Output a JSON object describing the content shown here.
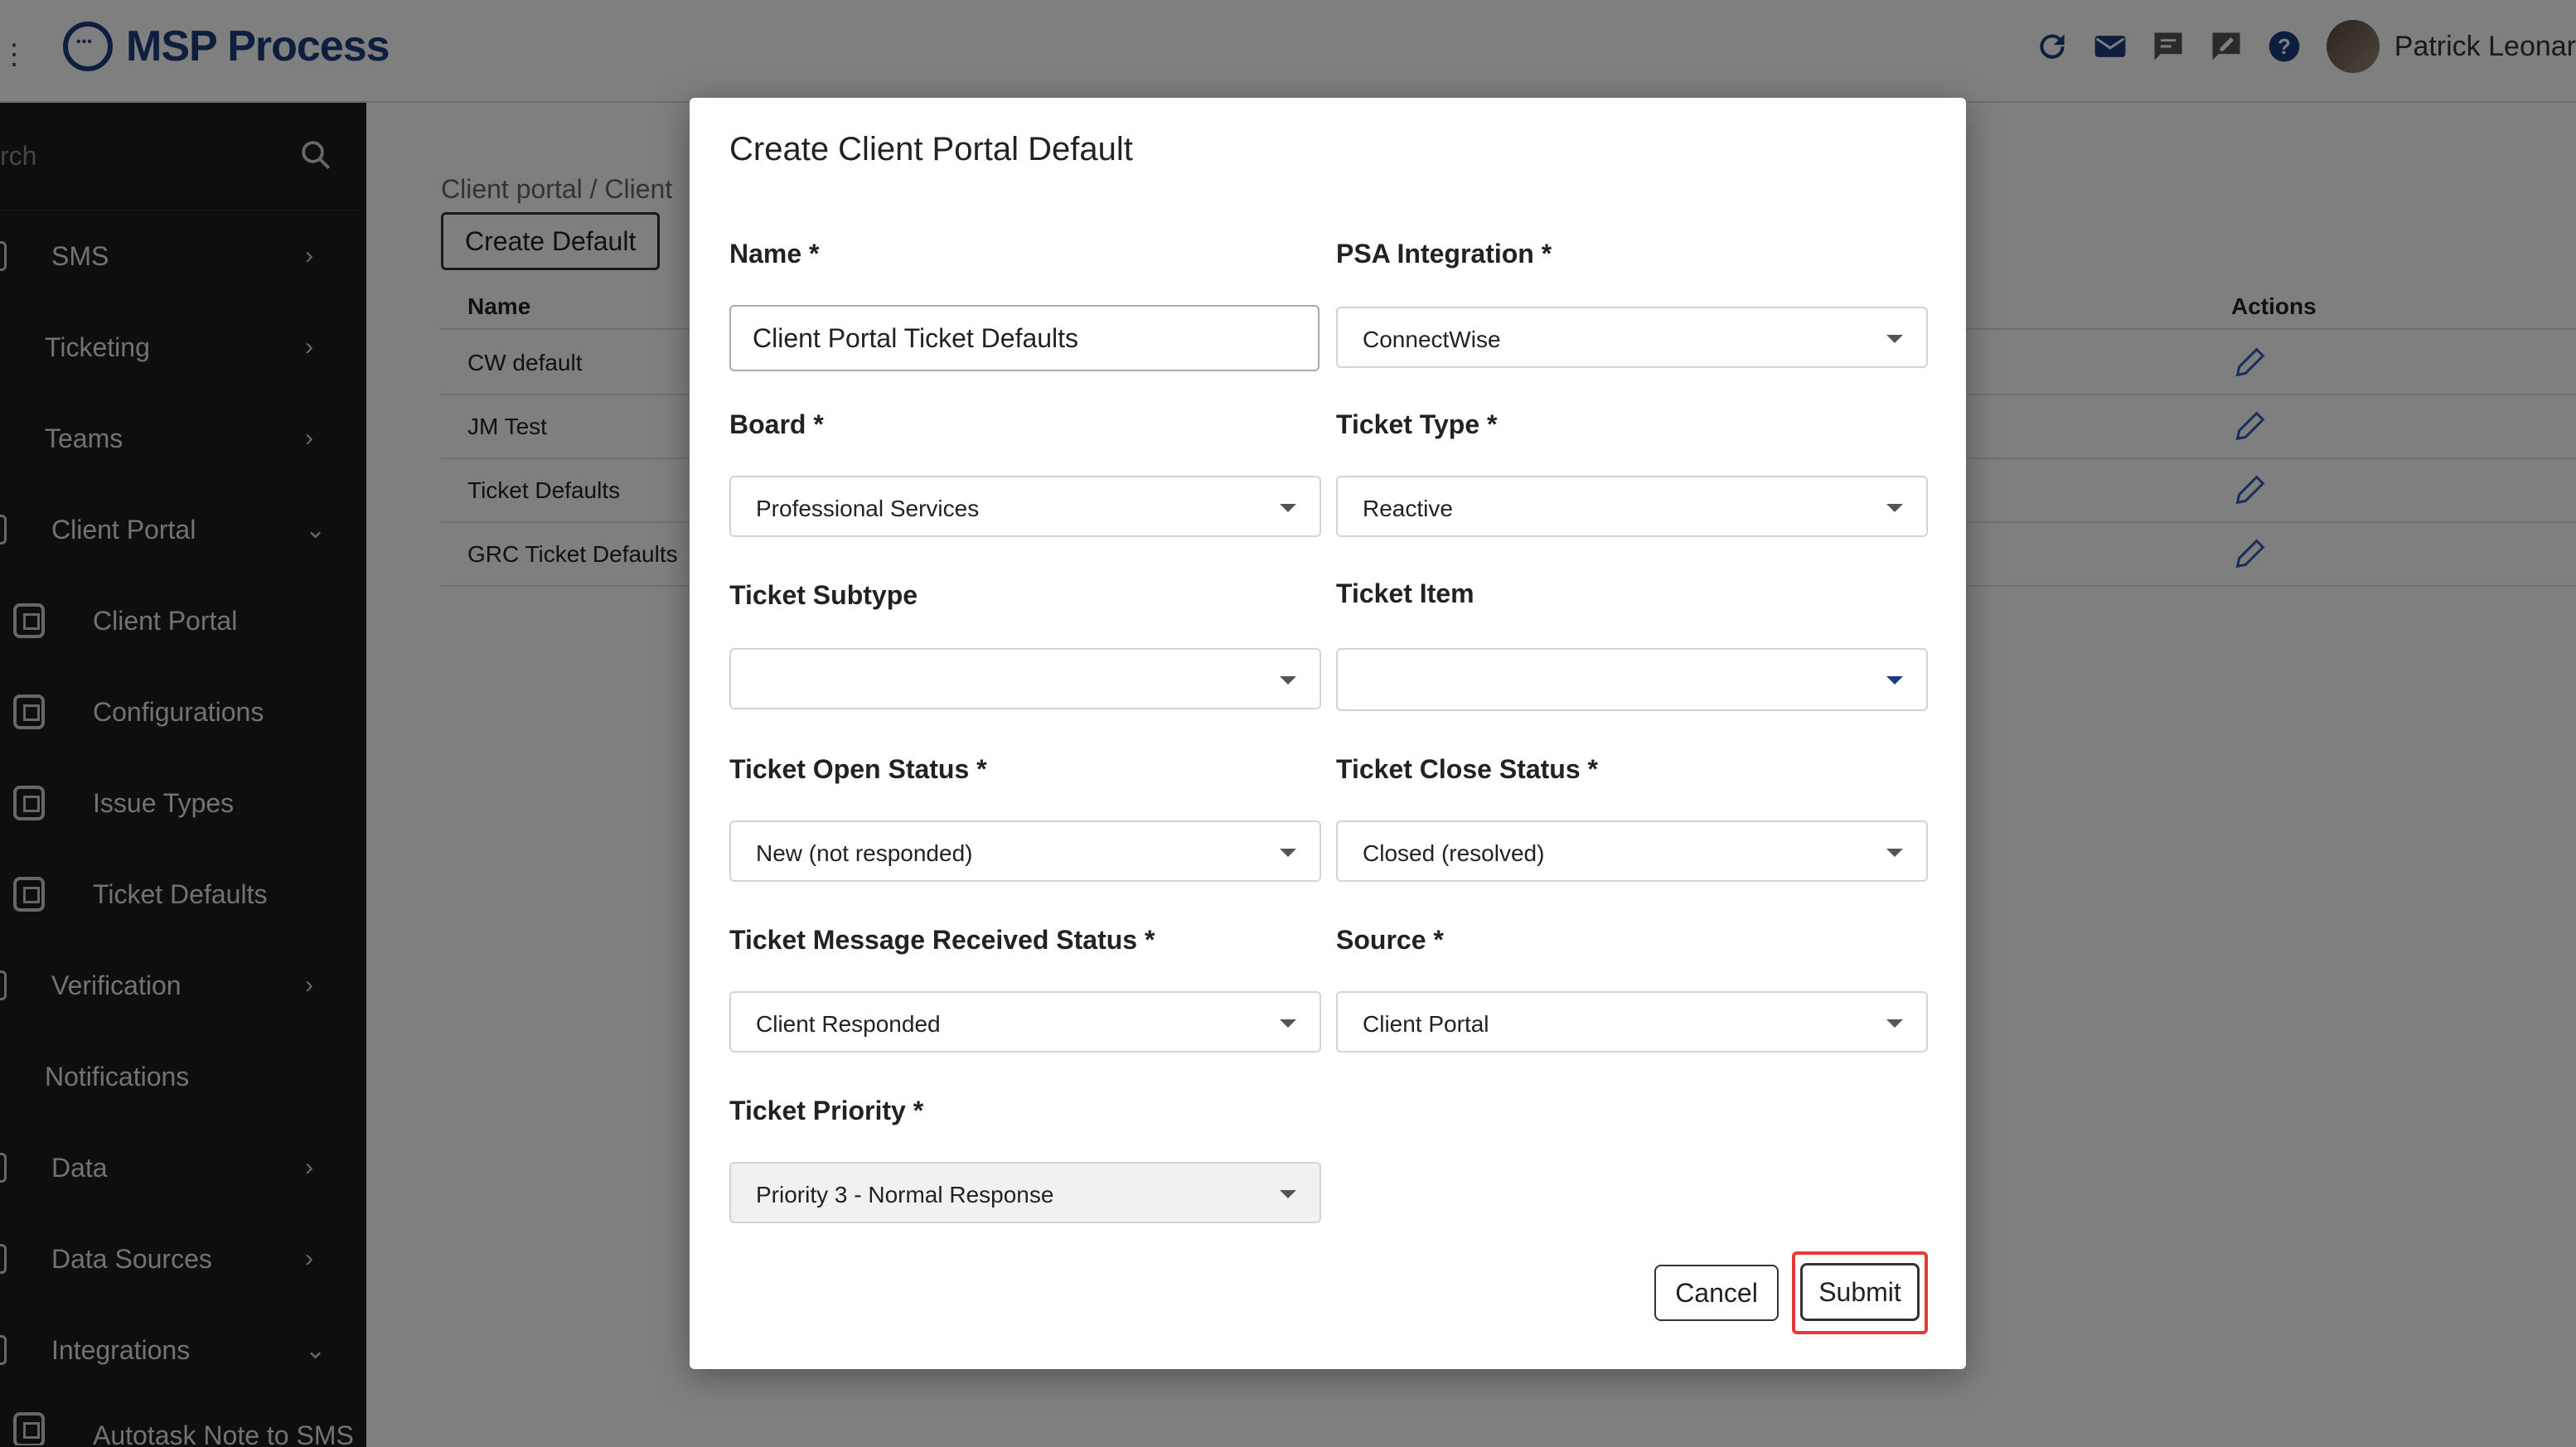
{
  "app": {
    "title": "MSP Process",
    "user_name": "Patrick Leonar",
    "top_icons": [
      "refresh-icon",
      "mail-icon",
      "chat-icon",
      "edit-note-icon",
      "help-icon"
    ]
  },
  "sidebar": {
    "search_placeholder": "rch",
    "items": [
      {
        "label": "SMS",
        "chevron": "›"
      },
      {
        "label": "Ticketing",
        "chevron": "›"
      },
      {
        "label": "Teams",
        "chevron": "›"
      },
      {
        "label": "Client Portal",
        "chevron": "⌄"
      },
      {
        "label": "Client Portal"
      },
      {
        "label": "Configurations"
      },
      {
        "label": "Issue Types"
      },
      {
        "label": "Ticket Defaults"
      },
      {
        "label": "Verification",
        "chevron": "›"
      },
      {
        "label": "Notifications"
      },
      {
        "label": "Data",
        "chevron": "›"
      },
      {
        "label": "Data Sources",
        "chevron": "›"
      },
      {
        "label": "Integrations",
        "chevron": "⌄"
      },
      {
        "label": "Autotask Note to SMS"
      }
    ]
  },
  "main": {
    "breadcrumb": "Client portal  /  Client",
    "create_button": "Create Default",
    "columns": {
      "name": "Name",
      "actions": "Actions"
    },
    "rows": [
      {
        "name": "CW default"
      },
      {
        "name": "JM Test"
      },
      {
        "name": "Ticket Defaults"
      },
      {
        "name": "GRC Ticket Defaults"
      }
    ]
  },
  "modal": {
    "title": "Create Client Portal Default",
    "name": {
      "label": "Name *",
      "value": "Client Portal Ticket Defaults"
    },
    "psa_integration": {
      "label": "PSA Integration *",
      "value": "ConnectWise"
    },
    "board": {
      "label": "Board *",
      "value": "Professional Services"
    },
    "ticket_type": {
      "label": "Ticket Type *",
      "value": "Reactive"
    },
    "ticket_subtype": {
      "label": "Ticket Subtype",
      "value": ""
    },
    "ticket_item": {
      "label": "Ticket Item",
      "value": ""
    },
    "ticket_open_status": {
      "label": "Ticket Open Status *",
      "value": "New (not responded)"
    },
    "ticket_close_status": {
      "label": "Ticket Close Status *",
      "value": "Closed (resolved)"
    },
    "ticket_message_received_status": {
      "label": "Ticket Message Received Status *",
      "value": "Client Responded"
    },
    "source": {
      "label": "Source *",
      "value": "Client Portal"
    },
    "ticket_priority": {
      "label": "Ticket Priority *",
      "value": "Priority 3 - Normal Response"
    },
    "cancel_label": "Cancel",
    "submit_label": "Submit"
  },
  "colors": {
    "brand": "#1a3d7c",
    "sidebar_bg": "#1c1c1c",
    "highlight": "#e53935",
    "edit_icon": "#2f5fb3"
  }
}
